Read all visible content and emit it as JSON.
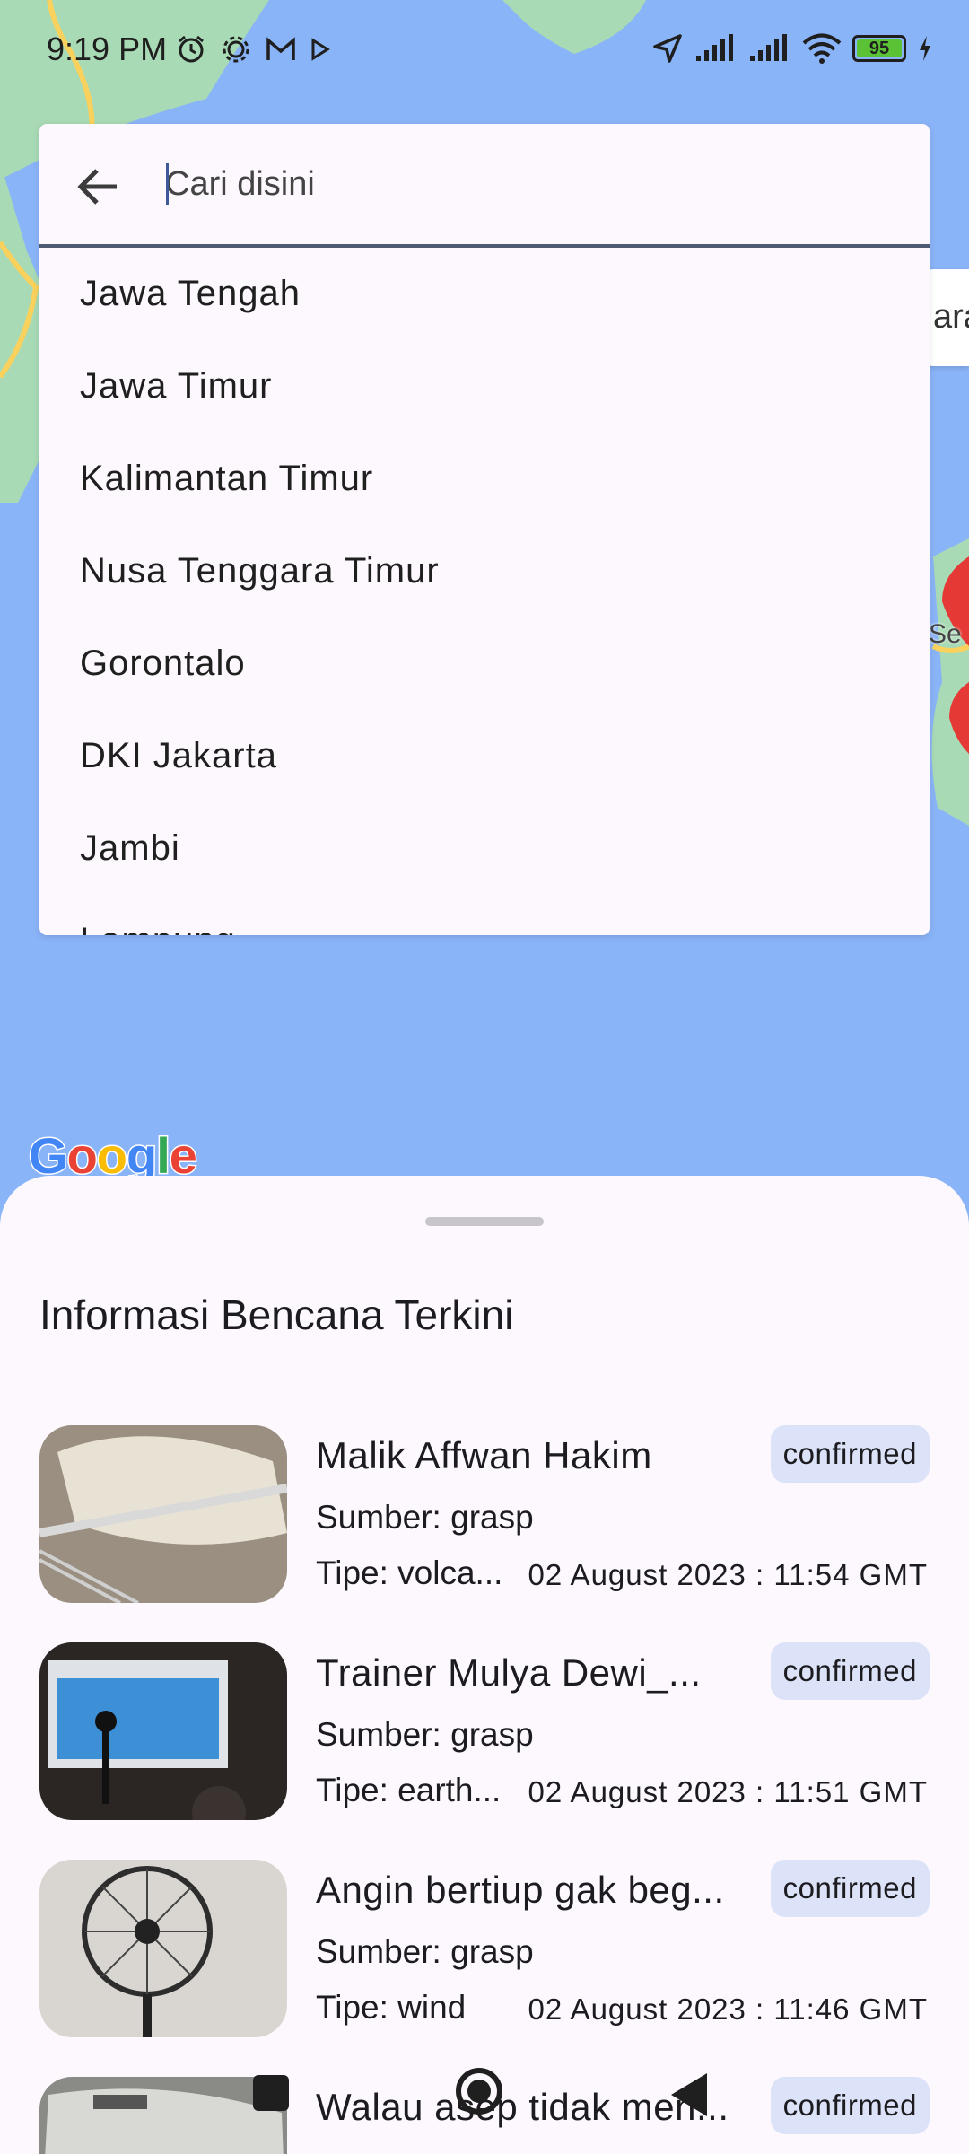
{
  "status_bar": {
    "time": "9:19 PM",
    "battery": "95"
  },
  "search": {
    "placeholder": "Cari disini",
    "value": ""
  },
  "map": {
    "chip_text": "ara",
    "pin_label": "Se",
    "logo": "Google"
  },
  "provinces": [
    "Jawa Tengah",
    "Jawa Timur",
    "Kalimantan Timur",
    "Nusa Tenggara Timur",
    "Gorontalo",
    "DKI Jakarta",
    "Jambi",
    "Lampung"
  ],
  "sheet": {
    "title": "Informasi Bencana Terkini",
    "reports": [
      {
        "title": "Malik Affwan Hakim",
        "source": "Sumber: grasp",
        "type": "Tipe: volca...",
        "date": "02 August 2023 : 11:54 GMT",
        "status": "confirmed"
      },
      {
        "title": "Trainer Mulya Dewi_...",
        "source": "Sumber: grasp",
        "type": "Tipe: earth...",
        "date": "02 August 2023 : 11:51 GMT",
        "status": "confirmed"
      },
      {
        "title": "Angin bertiup gak beg...",
        "source": "Sumber: grasp",
        "type": "Tipe: wind",
        "date": "02 August 2023 : 11:46 GMT",
        "status": "confirmed"
      },
      {
        "title": "Walau asep tidak men...",
        "source": "",
        "type": "",
        "date": "",
        "status": "confirmed"
      }
    ]
  },
  "colors": {
    "accent": "#4d5a72",
    "badge": "#dce3f9",
    "water": "#8ab4f8",
    "land": "#a8dab5"
  }
}
